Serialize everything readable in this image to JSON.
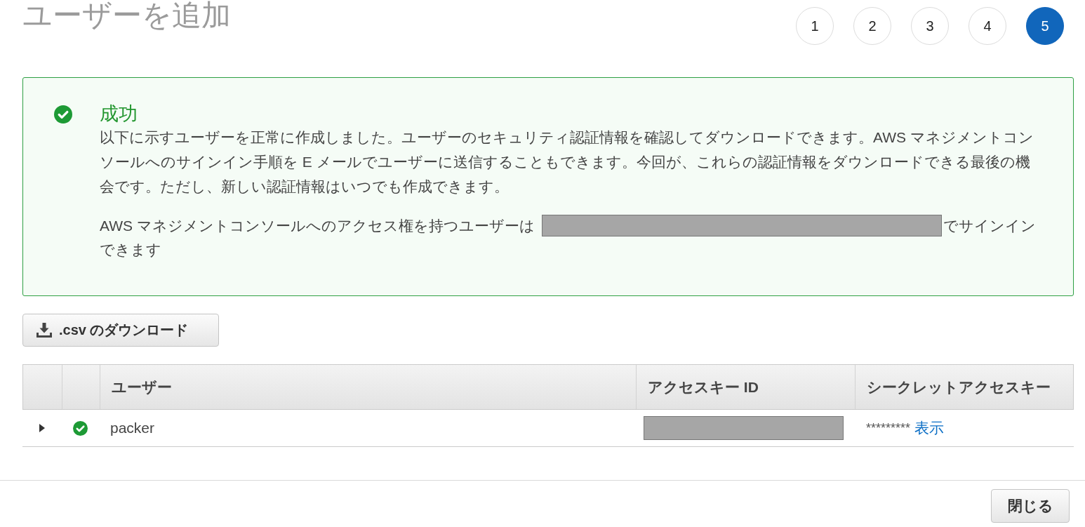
{
  "page": {
    "title": "ユーザーを追加"
  },
  "steps": [
    {
      "label": "1",
      "selected": false
    },
    {
      "label": "2",
      "selected": false
    },
    {
      "label": "3",
      "selected": false
    },
    {
      "label": "4",
      "selected": false
    },
    {
      "label": "5",
      "selected": true
    }
  ],
  "alert": {
    "kind": "success",
    "title": "成功",
    "message": "以下に示すユーザーを正常に作成しました。ユーザーのセキュリティ認証情報を確認してダウンロードできます。AWS マネジメントコンソールへのサインイン手順を E メールでユーザーに送信することもできます。今回が、これらの認証情報をダウンロードできる最後の機会です。ただし、新しい認証情報はいつでも作成できます。",
    "sign_in": {
      "text_before": "AWS マネジメントコンソールへのアクセス権を持つユーザーは",
      "link_redacted": true,
      "text_after": "でサインインできます"
    }
  },
  "download_button": {
    "label": ".csv のダウンロード"
  },
  "table": {
    "columns": [
      "ユーザー",
      "アクセスキー ID",
      "シークレットアクセスキー"
    ],
    "rows": [
      {
        "expanded": false,
        "succeeded": true,
        "user": "packer",
        "access_key_id_redacted": true,
        "secret_access_key": "*********",
        "show_link": "表示"
      }
    ]
  },
  "footer": {
    "close_button": "閉じる"
  }
}
